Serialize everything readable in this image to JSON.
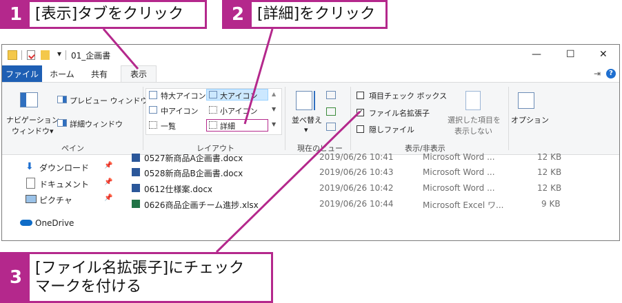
{
  "callouts": [
    {
      "num": "1",
      "text": "[表示]タブをクリック"
    },
    {
      "num": "2",
      "text": "[詳細]をクリック"
    },
    {
      "num": "3",
      "text": "[ファイル名拡張子]にチェック\nマークを付ける"
    }
  ],
  "window": {
    "title": "01_企画書",
    "controls": {
      "minimize": "—",
      "maximize": "☐",
      "close": "✕"
    },
    "tabs": {
      "file": "ファイル",
      "home": "ホーム",
      "share": "共有",
      "view": "表示"
    }
  },
  "ribbon": {
    "pane": {
      "nav_pane_line1": "ナビゲーション",
      "nav_pane_line2": "ウィンドウ▾",
      "preview_pane": "プレビュー ウィンドウ",
      "details_pane": "詳細ウィンドウ",
      "group_label": "ペイン"
    },
    "layout": {
      "extra_large": "特大アイコン",
      "large": "大アイコン",
      "medium": "中アイコン",
      "small": "小アイコン",
      "list": "一覧",
      "details": "詳細",
      "group_label": "レイアウト"
    },
    "current_view": {
      "sort_line1": "並べ替え",
      "sort_line2": "▾",
      "group_label": "現在のビュー"
    },
    "show_hide": {
      "item_checkboxes": "項目チェック ボックス",
      "file_extensions": "ファイル名拡張子",
      "hidden_items": "隠しファイル",
      "hide_selected_line1": "選択した項目を",
      "hide_selected_line2": "表示しない",
      "group_label": "表示/非表示"
    },
    "options": {
      "label": "オプション"
    }
  },
  "nav": {
    "items": [
      {
        "label": "ダウンロード",
        "icon": "download-icon"
      },
      {
        "label": "ドキュメント",
        "icon": "documents-icon"
      },
      {
        "label": "ピクチャ",
        "icon": "pictures-icon"
      },
      {
        "label": "OneDrive",
        "icon": "onedrive-icon"
      }
    ]
  },
  "files": [
    {
      "name": "0527新商品A企画書.docx",
      "date": "2019/06/26 10:41",
      "type": "Microsoft Word ...",
      "size": "12 KB",
      "icon": "word-icon"
    },
    {
      "name": "0528新商品B企画書.docx",
      "date": "2019/06/26 10:43",
      "type": "Microsoft Word ...",
      "size": "12 KB",
      "icon": "word-icon"
    },
    {
      "name": "0612仕様案.docx",
      "date": "2019/06/26 10:42",
      "type": "Microsoft Word ...",
      "size": "12 KB",
      "icon": "word-icon"
    },
    {
      "name": "0626商品企画チーム進捗.xlsx",
      "date": "2019/06/26 10:44",
      "type": "Microsoft Excel ワ...",
      "size": "9 KB",
      "icon": "excel-icon"
    }
  ],
  "colors": {
    "accent": "#b4288c",
    "tab_blue": "#1e5fb4",
    "selected": "#cce8ff",
    "word": "#2b579a",
    "excel": "#217346"
  }
}
